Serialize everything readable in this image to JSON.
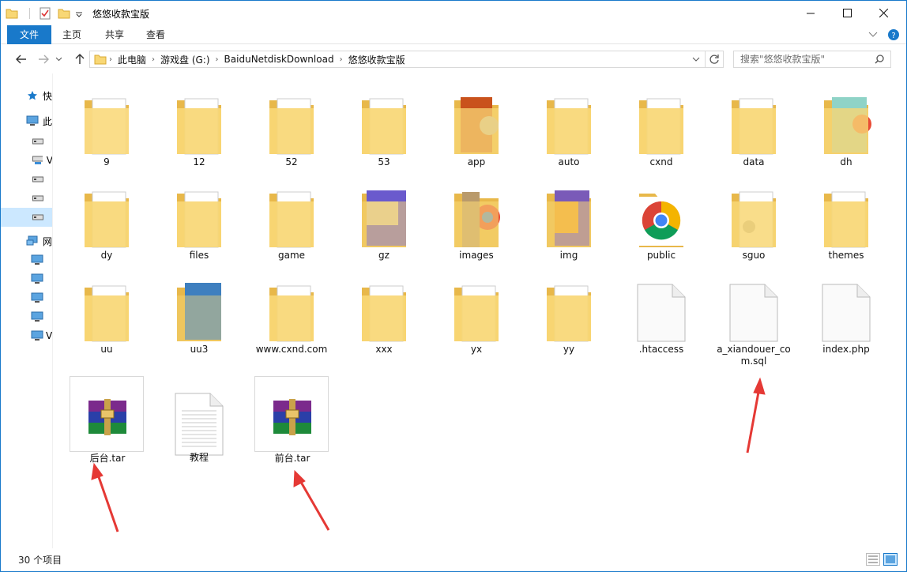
{
  "window": {
    "title": "悠悠收款宝版"
  },
  "ribbon": {
    "tabs": [
      "文件",
      "主页",
      "共享",
      "查看"
    ]
  },
  "address": {
    "crumbs": [
      "此电脑",
      "游戏盘 (G:)",
      "BaiduNetdiskDownload",
      "悠悠收款宝版"
    ]
  },
  "search": {
    "placeholder": "搜索\"悠悠收款宝版\""
  },
  "navpane": {
    "items": [
      {
        "label": "快",
        "icon": "star-icon"
      },
      {
        "label": "此",
        "icon": "computer-icon"
      },
      {
        "label": "\u0000",
        "icon": "drive-icon"
      },
      {
        "label": "V",
        "icon": "network-drive-icon"
      },
      {
        "label": "\u0000",
        "icon": "drive-icon"
      },
      {
        "label": "\u0000",
        "icon": "drive-icon"
      },
      {
        "label": "\u0000",
        "icon": "drive-icon"
      },
      {
        "label": "网",
        "icon": "network-icon"
      },
      {
        "label": "\u0000",
        "icon": "monitor-icon"
      },
      {
        "label": "\u0000",
        "icon": "monitor-icon"
      },
      {
        "label": "\u0000",
        "icon": "monitor-icon"
      },
      {
        "label": "\u0000",
        "icon": "monitor-icon"
      },
      {
        "label": "V",
        "icon": "monitor-icon"
      }
    ]
  },
  "files": [
    {
      "name": "9",
      "icon": "folder-icon"
    },
    {
      "name": "12",
      "icon": "folder-icon"
    },
    {
      "name": "52",
      "icon": "folder-icon"
    },
    {
      "name": "53",
      "icon": "folder-icon"
    },
    {
      "name": "app",
      "icon": "folder-icon"
    },
    {
      "name": "auto",
      "icon": "folder-icon"
    },
    {
      "name": "cxnd",
      "icon": "folder-icon"
    },
    {
      "name": "data",
      "icon": "folder-icon"
    },
    {
      "name": "dh",
      "icon": "folder-icon"
    },
    {
      "name": "dy",
      "icon": "folder-icon"
    },
    {
      "name": "files",
      "icon": "folder-icon"
    },
    {
      "name": "game",
      "icon": "folder-icon"
    },
    {
      "name": "gz",
      "icon": "folder-icon"
    },
    {
      "name": "images",
      "icon": "folder-icon"
    },
    {
      "name": "img",
      "icon": "folder-icon"
    },
    {
      "name": "public",
      "icon": "chrome-icon"
    },
    {
      "name": "sguo",
      "icon": "folder-icon"
    },
    {
      "name": "themes",
      "icon": "folder-icon"
    },
    {
      "name": "uu",
      "icon": "folder-icon"
    },
    {
      "name": "uu3",
      "icon": "folder-icon"
    },
    {
      "name": "www.cxnd.com",
      "icon": "folder-icon"
    },
    {
      "name": "xxx",
      "icon": "folder-icon"
    },
    {
      "name": "yx",
      "icon": "folder-icon"
    },
    {
      "name": "yy",
      "icon": "folder-icon"
    },
    {
      "name": ".htaccess",
      "icon": "blank-file-icon"
    },
    {
      "name": "a_xiandouer_com.sql",
      "icon": "blank-file-icon"
    },
    {
      "name": "index.php",
      "icon": "blank-file-icon"
    },
    {
      "name": "后台.tar",
      "icon": "winrar-archive-icon"
    },
    {
      "name": "教程",
      "icon": "text-document-icon"
    },
    {
      "name": "前台.tar",
      "icon": "winrar-archive-icon"
    }
  ],
  "status": {
    "item_count": "30 个项目"
  },
  "colors": {
    "accent": "#1979ca",
    "folder": "#f8d775",
    "arrow": "#e53935"
  }
}
